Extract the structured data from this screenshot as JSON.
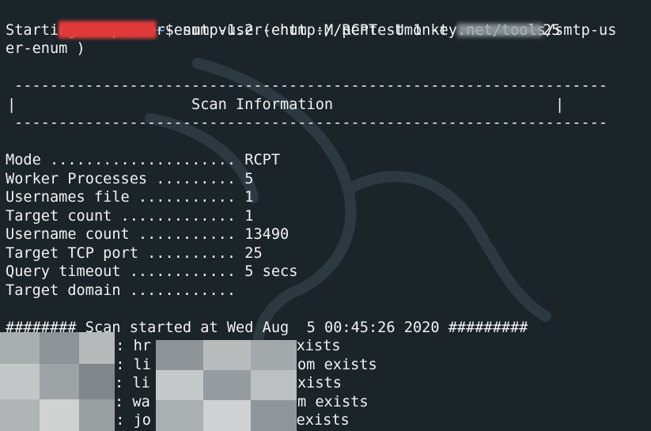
{
  "terminal": {
    "prompt": {
      "path_symbol": "~",
      "dollar": "$"
    },
    "command": "smtp-user-enum -M RCPT -U 1 -t",
    "command_tail": "25",
    "starting_line_1": "Starting smtp-user-enum v1.2 ( http://pentestmonkey.net/tools/smtp-us",
    "starting_line_2": "er-enum )",
    "banner": {
      "rule": "-------------------------------------------------------------------",
      "left_bar": "|",
      "right_bar": "|",
      "title": "Scan Information"
    },
    "scan_info": [
      {
        "key": "Mode .....................",
        "value": "RCPT"
      },
      {
        "key": "Worker Processes .........",
        "value": "5"
      },
      {
        "key": "Usernames file ...........",
        "value": "1"
      },
      {
        "key": "Target count .............",
        "value": "1"
      },
      {
        "key": "Username count ...........",
        "value": "13490"
      },
      {
        "key": "Target TCP port ..........",
        "value": "25"
      },
      {
        "key": "Query timeout ............",
        "value": "5 secs"
      },
      {
        "key": "Target domain ............",
        "value": ""
      }
    ],
    "scan_started": "######## Scan started at Wed Aug  5 00:45:26 2020 #########",
    "results": [
      {
        "visible_a": "5: hr",
        "visible_b": "n exists"
      },
      {
        "visible_a": "5: li",
        "visible_b": "om exists"
      },
      {
        "visible_a": ": li",
        "visible_b": "exists"
      },
      {
        "visible_a": ": wa",
        "visible_b": "om exists"
      },
      {
        "visible_a": "5: jo",
        "visible_b": "om exists"
      }
    ]
  },
  "colors": {
    "background": "#1b2429",
    "text": "#f2f2f2",
    "prompt_path": "#5fa8ff",
    "prompt_user": "#e23a3a",
    "redaction": "#9aa3a7"
  }
}
